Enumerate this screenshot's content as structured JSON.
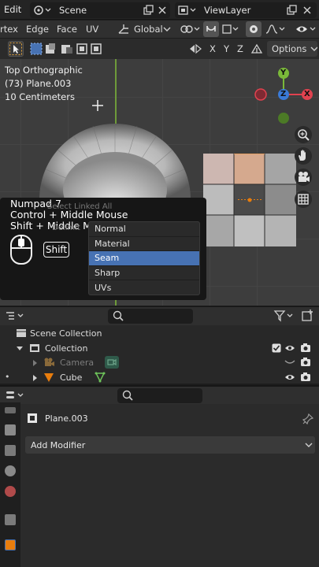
{
  "topbar": {
    "edit_label": "Edit",
    "scene_label": "Scene",
    "viewlayer_label": "ViewLayer"
  },
  "header": {
    "menus": [
      "rtex",
      "Edge",
      "Face",
      "UV"
    ],
    "orientation": "Global",
    "options_label": "Options",
    "axes": [
      "X",
      "Y",
      "Z"
    ]
  },
  "viewport": {
    "view_name": "Top Orthographic",
    "object_info": "(73) Plane.003",
    "scale_info": "10 Centimeters",
    "gizmo": {
      "y": "Y",
      "x": "X",
      "z": "Z"
    }
  },
  "shortcut_overlay": {
    "lines": [
      "Numpad 7",
      "Control + Middle Mouse",
      "Shift + Middle Mouse"
    ],
    "key_label": "Shift",
    "faded_text_1": "Select Linked All",
    "faded_text_2": "Delimit"
  },
  "edge_menu": {
    "items": [
      "Normal",
      "Material",
      "Seam",
      "Sharp",
      "UVs"
    ],
    "selected": "Seam"
  },
  "outliner": {
    "rows": [
      {
        "label": "Scene Collection"
      },
      {
        "label": "Collection"
      },
      {
        "label": "Camera"
      },
      {
        "label": "Cube"
      }
    ]
  },
  "properties": {
    "object_name": "Plane.003",
    "add_modifier_label": "Add Modifier"
  },
  "colors": {
    "accent": "#4772b3",
    "x_axis": "#e0424f",
    "y_axis": "#7ab839",
    "z_axis": "#3a7ad6",
    "orange": "#e87d0d"
  }
}
